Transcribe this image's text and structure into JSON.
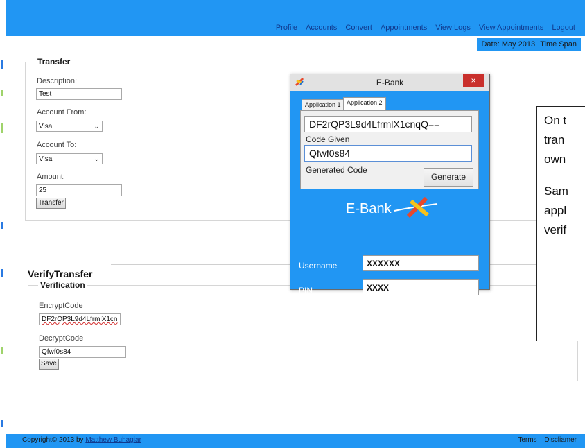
{
  "nav": {
    "items": [
      "Profile",
      "Accounts",
      "Convert",
      "Appointments",
      "View Logs",
      "View Appointments",
      "Logout"
    ]
  },
  "status": {
    "date": "Date: May 2013",
    "time_span": "Time Span"
  },
  "transfer": {
    "legend": "Transfer",
    "description_label": "Description:",
    "description_value": "Test",
    "account_from_label": "Account From:",
    "account_from_value": "Visa",
    "account_to_label": "Account To:",
    "account_to_value": "Visa",
    "amount_label": "Amount:",
    "amount_value": "25",
    "transfer_button": "Transfer"
  },
  "verify": {
    "title": "VerifyTransfer",
    "legend": "Verification",
    "encrypt_label": "EncryptCode",
    "encrypt_value": "DF2rQP3L9d4LfrmlX1cn",
    "decrypt_label": "DecryptCode",
    "decrypt_value": "Qfwf0s84",
    "save_button": "Save"
  },
  "ebank": {
    "title": "E-Bank",
    "close": "×",
    "tabs": [
      "Application 1",
      "Application 2"
    ],
    "code": "DF2rQP3L9d4LfrmlX1cnqQ==",
    "code_given_label": "Code Given",
    "code_given_value": "Qfwf0s84",
    "generated_code_label": "Generated Code",
    "generate_button": "Generate",
    "logo_text": "E-Bank",
    "username_label": "Username",
    "username_value": "XXXXXX",
    "pin_label": "PIN",
    "pin_value": "XXXX"
  },
  "callout": {
    "lines": [
      "On t",
      "tran",
      "own",
      "Sam",
      "appl",
      "verif"
    ]
  },
  "footer": {
    "copyright": "Copyright© 2013 by ",
    "author": "Matthew Buhagiar",
    "links": [
      "Terms",
      "Discliamer"
    ]
  },
  "colors": {
    "brand_blue": "#2196f3",
    "link_blue": "#103a8e",
    "close_red": "#c9302c"
  }
}
